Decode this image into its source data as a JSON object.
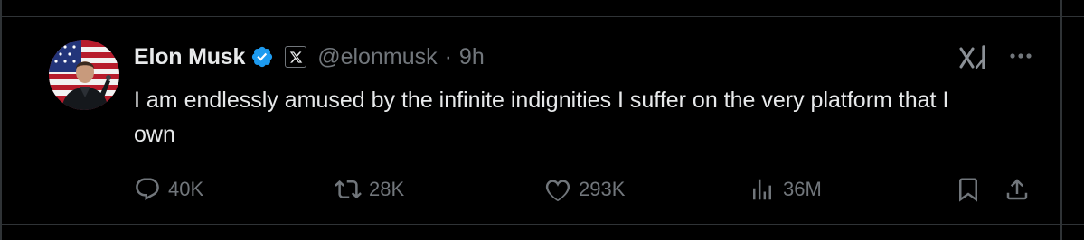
{
  "tweet": {
    "author": {
      "display_name": "Elon Musk",
      "handle": "@elonmusk",
      "verified_icon": "verified-badge-icon",
      "affiliation_icon": "x-logo-icon"
    },
    "separator": "·",
    "time": "9h",
    "text": "I am endlessly amused by the infinite indignities I suffer on the very platform that I own",
    "actions": {
      "replies": "40K",
      "reposts": "28K",
      "likes": "293K",
      "views": "36M"
    },
    "icons": {
      "grok": "grok-icon",
      "more": "more-icon",
      "reply": "reply-icon",
      "repost": "repost-icon",
      "like": "heart-icon",
      "views": "views-icon",
      "bookmark": "bookmark-icon",
      "share": "share-icon"
    }
  },
  "colors": {
    "background": "#000000",
    "text_primary": "#e7e9ea",
    "text_secondary": "#71767b",
    "verified_blue": "#1d9bf0",
    "divider": "#2f3336"
  }
}
